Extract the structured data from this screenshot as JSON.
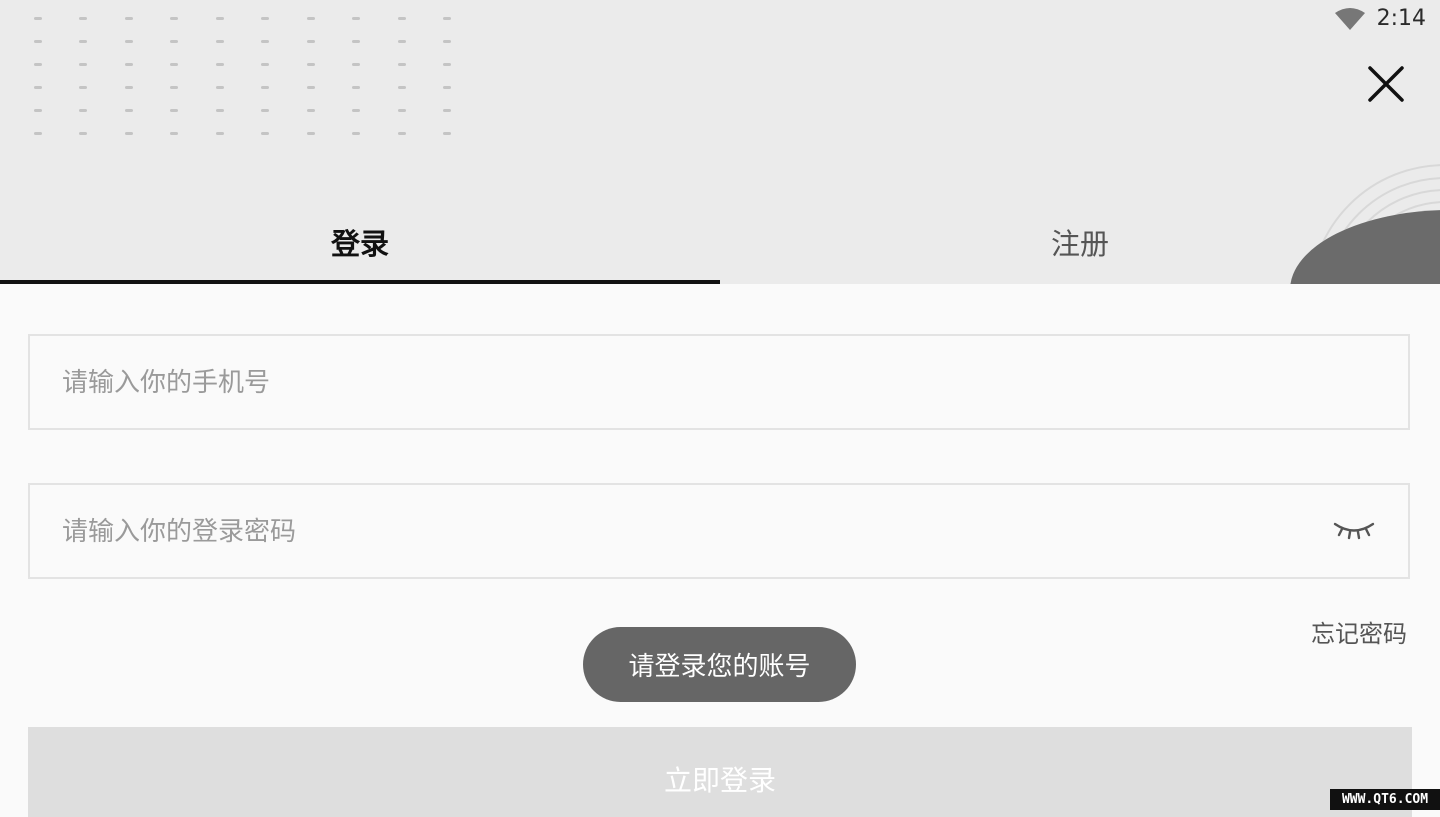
{
  "status_bar": {
    "time": "2:14",
    "wifi_icon": "wifi-icon"
  },
  "tabs": {
    "login": "登录",
    "register": "注册"
  },
  "form": {
    "phone_placeholder": "请输入你的手机号",
    "password_placeholder": "请输入你的登录密码",
    "forgot_password": "忘记密码",
    "submit": "立即登录"
  },
  "toast": {
    "message": "请登录您的账号"
  },
  "watermark": "WWW.QT6.COM",
  "icons": [
    "close-icon",
    "eye-closed-icon",
    "wifi-icon"
  ],
  "colors": {
    "header_bg": "#ebebeb",
    "toast_bg": "#666666",
    "button_bg": "#dedede",
    "tab_indicator": "#111111"
  }
}
